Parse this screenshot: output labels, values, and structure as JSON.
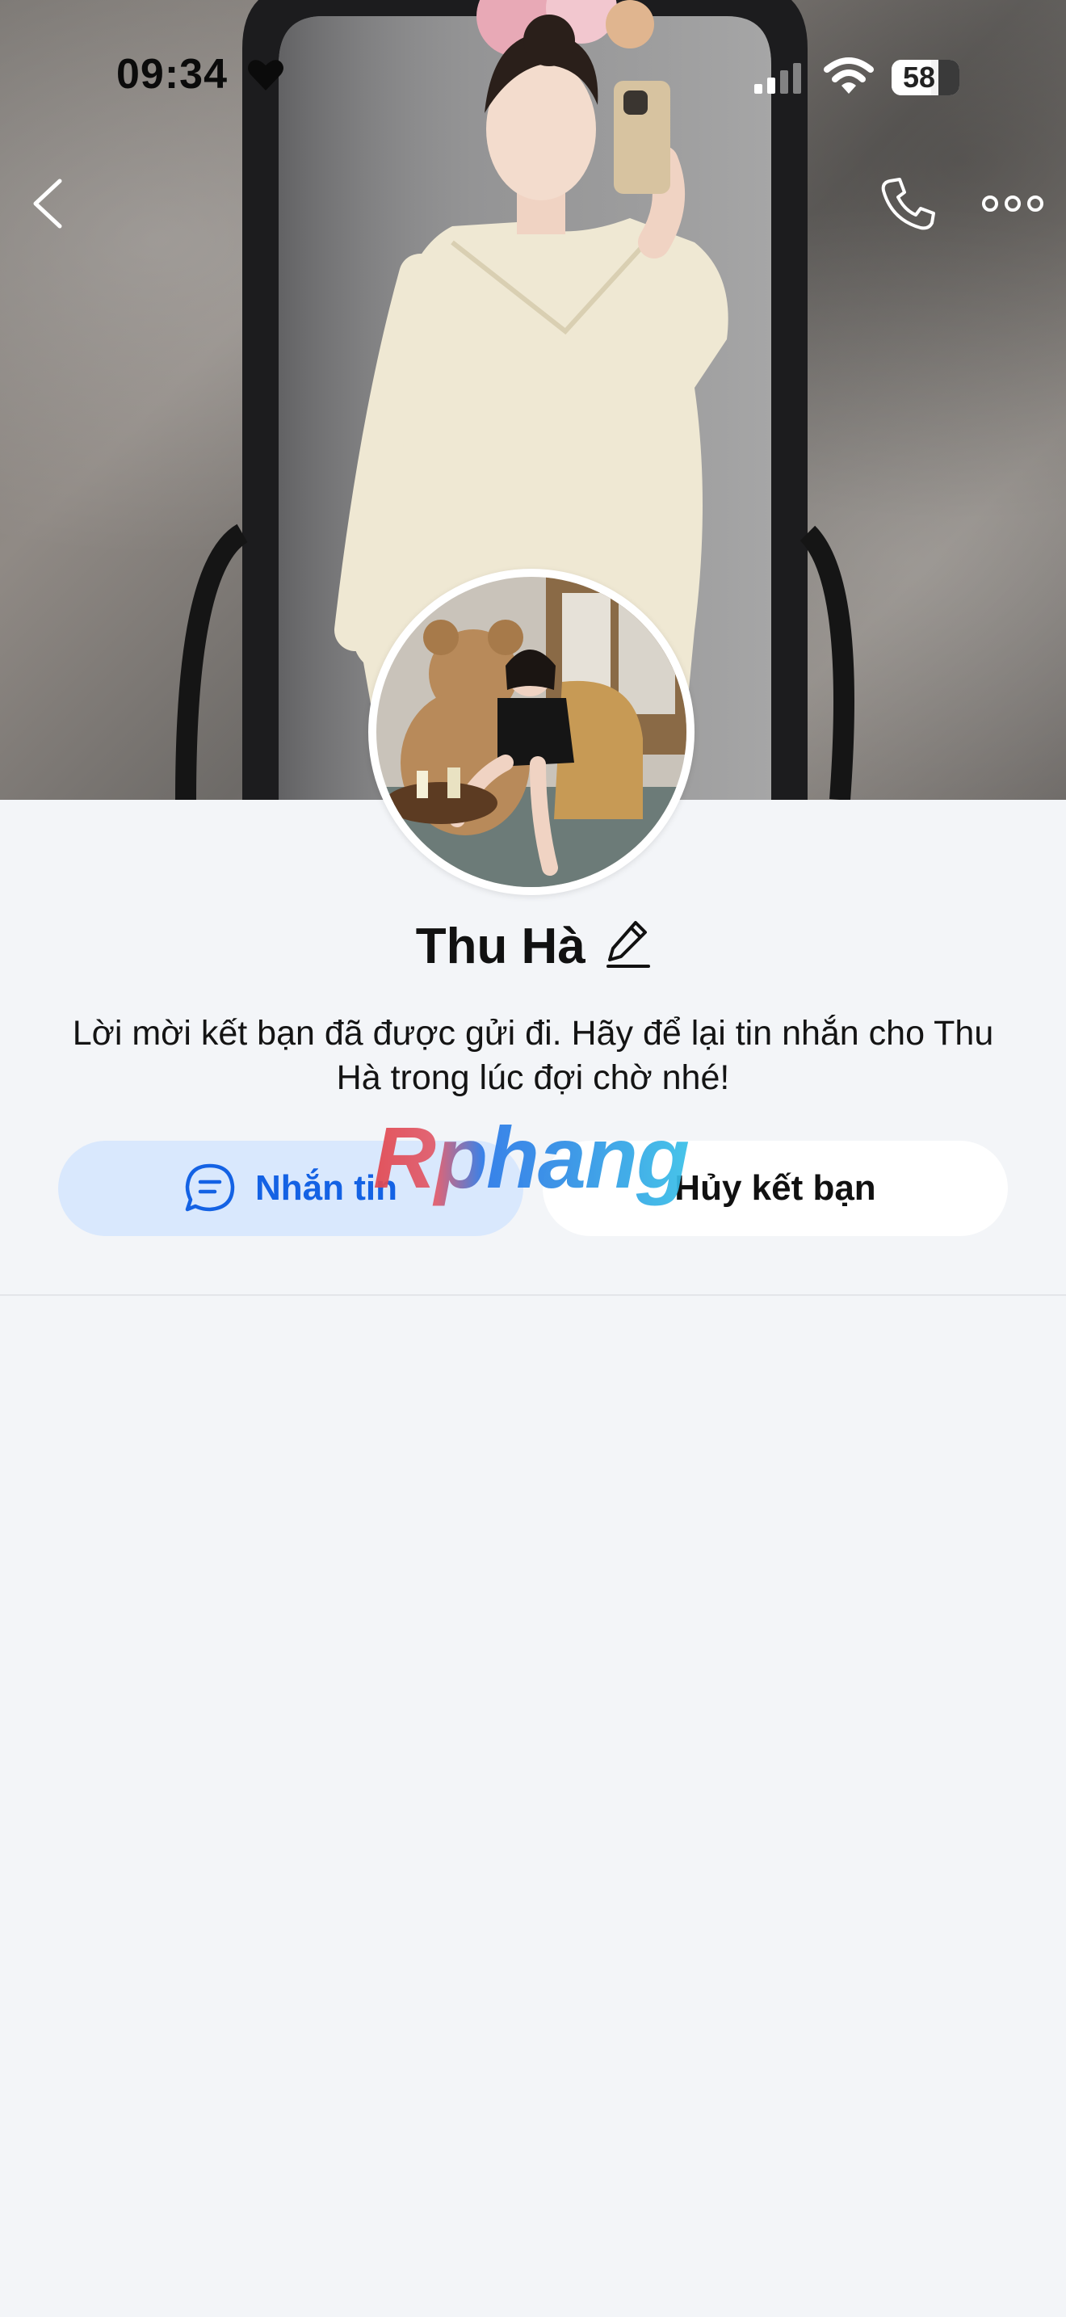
{
  "status_bar": {
    "time": "09:34",
    "battery_level": "58",
    "battery_percent": 58
  },
  "profile": {
    "name": "Thu Hà",
    "request_message": "Lời mời kết bạn đã được gửi đi. Hãy để lại tin nhắn cho Thu Hà trong lúc đợi chờ nhé!"
  },
  "actions": {
    "message_label": "Nhắn tin",
    "unfriend_label": "Hủy kết bạn"
  },
  "watermark": "Rphang",
  "icons": {
    "heart": "heart-icon",
    "signal": "cellular-signal-icon",
    "wifi": "wifi-icon",
    "back": "chevron-left-icon",
    "call": "phone-icon",
    "more": "more-horizontal-icon",
    "edit": "pencil-icon",
    "message": "chat-bubble-icon"
  },
  "colors": {
    "accent": "#1462e4",
    "message_button_bg": "#d9e8fd",
    "page_bg": "#f3f5f8"
  }
}
